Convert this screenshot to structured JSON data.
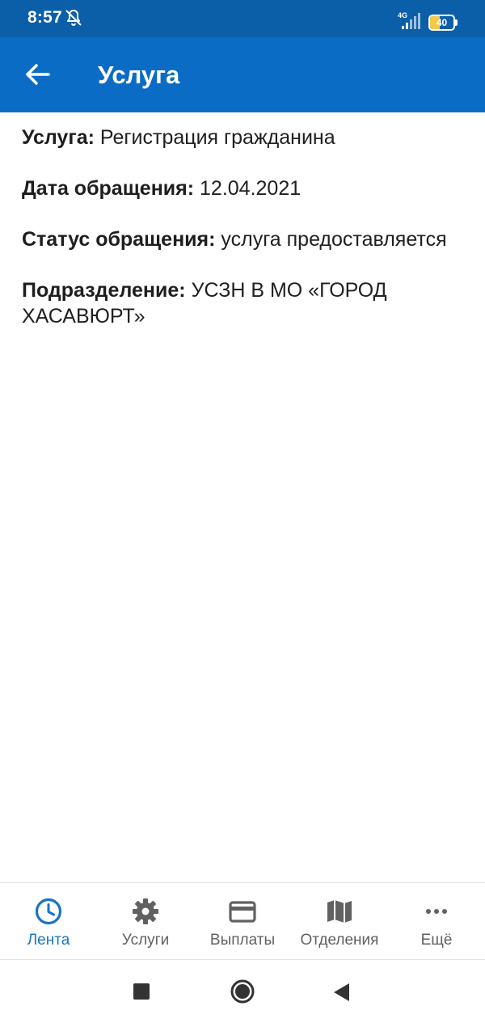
{
  "status_bar": {
    "time": "8:57",
    "network": "4G",
    "battery_level": "40",
    "battery_fraction": 0.4
  },
  "app_bar": {
    "title": "Услуга"
  },
  "details": [
    {
      "label": "Услуга:",
      "value": " Регистрация гражданина"
    },
    {
      "label": "Дата обращения:",
      "value": " 12.04.2021"
    },
    {
      "label": "Статус обращения:",
      "value": " услуга предоставляется"
    },
    {
      "label": "Подразделение:",
      "value": " УСЗН В МО «ГОРОД ХАСАВЮРТ»"
    }
  ],
  "bottom_nav": {
    "items": [
      {
        "label": "Лента",
        "icon": "clock-icon",
        "active": true
      },
      {
        "label": "Услуги",
        "icon": "gear-icon",
        "active": false
      },
      {
        "label": "Выплаты",
        "icon": "credit-card-icon",
        "active": false
      },
      {
        "label": "Отделения",
        "icon": "map-icon",
        "active": false
      },
      {
        "label": "Ещё",
        "icon": "more-horizontal-icon",
        "active": false
      }
    ]
  },
  "colors": {
    "status_bar": "#0b5ea8",
    "app_bar": "#0b6cc6",
    "active_nav": "#1a73c4",
    "inactive_nav": "#616161"
  }
}
